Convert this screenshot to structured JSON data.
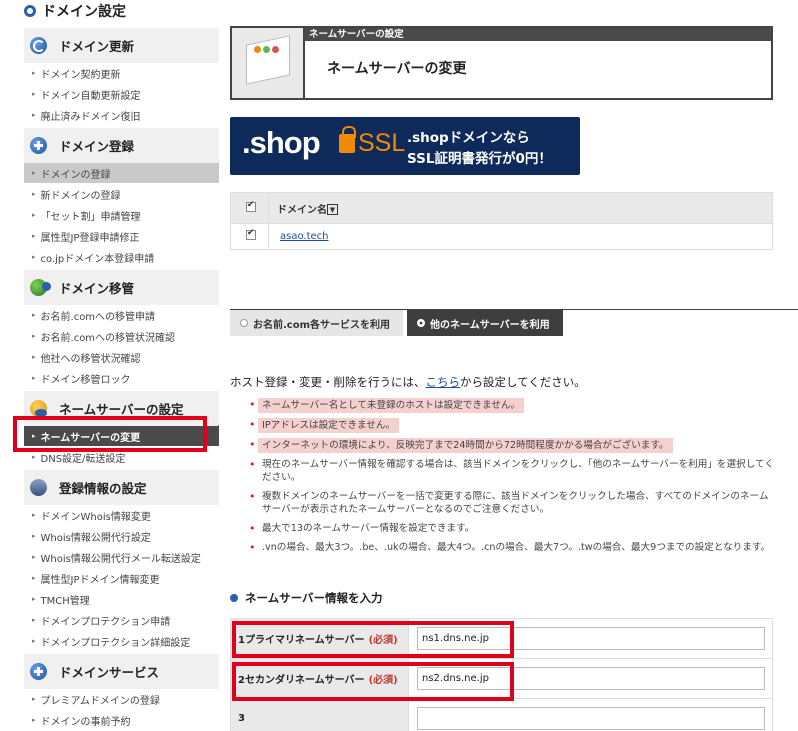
{
  "page_title": "ドメイン設定",
  "sidebar": [
    {
      "title": "ドメイン更新",
      "icon": "refresh-icon",
      "items": [
        "ドメイン契約更新",
        "ドメイン自動更新設定",
        "廃止済みドメイン復旧"
      ]
    },
    {
      "title": "ドメイン登録",
      "icon": "plus-icon",
      "items": [
        "ドメインの登録",
        "新ドメインの登録",
        "「セット割」申請管理",
        "属性型JP登録申請修正",
        "co.jpドメイン本登録申請"
      ]
    },
    {
      "title": "ドメイン移管",
      "icon": "globe-icon",
      "items": [
        "お名前.comへの移管申請",
        "お名前.comへの移管状況確認",
        "他社への移管状況確認",
        "ドメイン移管ロック"
      ]
    },
    {
      "title": "ネームサーバーの設定",
      "icon": "person-icon",
      "items": [
        "ネームサーバーの変更",
        "DNS設定/転送設定"
      ]
    },
    {
      "title": "登録情報の設定",
      "icon": "database-icon",
      "items": [
        "ドメインWhois情報変更",
        "Whois情報公開代行設定",
        "Whois情報公開代行メール転送設定",
        "属性型JPドメイン情報変更",
        "TMCH管理",
        "ドメインプロテクション申請",
        "ドメインプロテクション詳細設定"
      ]
    },
    {
      "title": "ドメインサービス",
      "icon": "plus-icon",
      "items": [
        "プレミアムドメインの登録",
        "ドメインの事前予約"
      ]
    }
  ],
  "header": {
    "bar_label": "ネームサーバーの設定",
    "title": "ネームサーバーの変更"
  },
  "banner": {
    "shop": ".shop",
    "ssl": "SSL",
    "line1": ".shopドメインなら",
    "line2": "SSL証明書発行が0円！"
  },
  "domain_table": {
    "header": "ドメイン名",
    "sort_icon": "▼",
    "rows": [
      "asao.tech"
    ]
  },
  "tabs": [
    "お名前.com各サービスを利用",
    "他のネームサーバーを利用"
  ],
  "intro": {
    "before": "ホスト登録・変更・削除を行うには、",
    "link": "こちら",
    "after": "から設定してください。"
  },
  "notes": [
    "ネームサーバー名として未登録のホストは設定できません。",
    "IPアドレスは設定できません。",
    "インターネットの環境により、反映完了まで24時間から72時間程度かかる場合がございます。",
    "現在のネームサーバー情報を確認する場合は、該当ドメインをクリックし、「他のネームサーバーを利用」を選択してください。",
    "複数ドメインのネームサーバーを一括で変更する際に、該当ドメインをクリックした場合、すべてのドメインのネームサーバーが表示されたネームサーバーとなるのでご注意ください。",
    "最大で13のネームサーバー情報を設定できます。",
    ".vnの場合、最大3つ。.be、.ukの場合、最大4つ。.cnの場合、最大7つ。.twの場合、最大9つまでの設定となります。"
  ],
  "ns_section": {
    "title": "ネームサーバー情報を入力",
    "required_label": "(必須)",
    "rows": [
      {
        "label": "1プライマリネームサーバー",
        "value": "ns1.dns.ne.jp"
      },
      {
        "label": "2セカンダリネームサーバー",
        "value": "ns2.dns.ne.jp"
      },
      {
        "label": "3",
        "value": ""
      }
    ]
  }
}
